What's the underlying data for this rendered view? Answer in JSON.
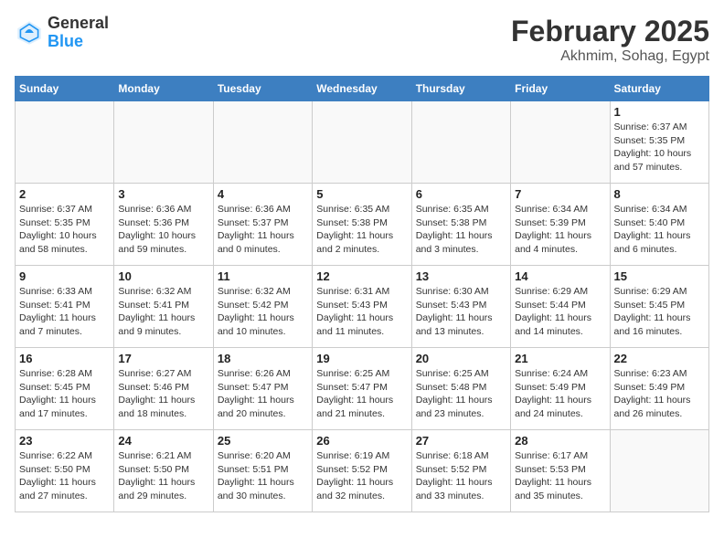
{
  "header": {
    "logo_general": "General",
    "logo_blue": "Blue",
    "month_title": "February 2025",
    "subtitle": "Akhmim, Sohag, Egypt"
  },
  "days_of_week": [
    "Sunday",
    "Monday",
    "Tuesday",
    "Wednesday",
    "Thursday",
    "Friday",
    "Saturday"
  ],
  "weeks": [
    [
      {
        "day": "",
        "info": ""
      },
      {
        "day": "",
        "info": ""
      },
      {
        "day": "",
        "info": ""
      },
      {
        "day": "",
        "info": ""
      },
      {
        "day": "",
        "info": ""
      },
      {
        "day": "",
        "info": ""
      },
      {
        "day": "1",
        "info": "Sunrise: 6:37 AM\nSunset: 5:35 PM\nDaylight: 10 hours and 57 minutes."
      }
    ],
    [
      {
        "day": "2",
        "info": "Sunrise: 6:37 AM\nSunset: 5:35 PM\nDaylight: 10 hours and 58 minutes."
      },
      {
        "day": "3",
        "info": "Sunrise: 6:36 AM\nSunset: 5:36 PM\nDaylight: 10 hours and 59 minutes."
      },
      {
        "day": "4",
        "info": "Sunrise: 6:36 AM\nSunset: 5:37 PM\nDaylight: 11 hours and 0 minutes."
      },
      {
        "day": "5",
        "info": "Sunrise: 6:35 AM\nSunset: 5:38 PM\nDaylight: 11 hours and 2 minutes."
      },
      {
        "day": "6",
        "info": "Sunrise: 6:35 AM\nSunset: 5:38 PM\nDaylight: 11 hours and 3 minutes."
      },
      {
        "day": "7",
        "info": "Sunrise: 6:34 AM\nSunset: 5:39 PM\nDaylight: 11 hours and 4 minutes."
      },
      {
        "day": "8",
        "info": "Sunrise: 6:34 AM\nSunset: 5:40 PM\nDaylight: 11 hours and 6 minutes."
      }
    ],
    [
      {
        "day": "9",
        "info": "Sunrise: 6:33 AM\nSunset: 5:41 PM\nDaylight: 11 hours and 7 minutes."
      },
      {
        "day": "10",
        "info": "Sunrise: 6:32 AM\nSunset: 5:41 PM\nDaylight: 11 hours and 9 minutes."
      },
      {
        "day": "11",
        "info": "Sunrise: 6:32 AM\nSunset: 5:42 PM\nDaylight: 11 hours and 10 minutes."
      },
      {
        "day": "12",
        "info": "Sunrise: 6:31 AM\nSunset: 5:43 PM\nDaylight: 11 hours and 11 minutes."
      },
      {
        "day": "13",
        "info": "Sunrise: 6:30 AM\nSunset: 5:43 PM\nDaylight: 11 hours and 13 minutes."
      },
      {
        "day": "14",
        "info": "Sunrise: 6:29 AM\nSunset: 5:44 PM\nDaylight: 11 hours and 14 minutes."
      },
      {
        "day": "15",
        "info": "Sunrise: 6:29 AM\nSunset: 5:45 PM\nDaylight: 11 hours and 16 minutes."
      }
    ],
    [
      {
        "day": "16",
        "info": "Sunrise: 6:28 AM\nSunset: 5:45 PM\nDaylight: 11 hours and 17 minutes."
      },
      {
        "day": "17",
        "info": "Sunrise: 6:27 AM\nSunset: 5:46 PM\nDaylight: 11 hours and 18 minutes."
      },
      {
        "day": "18",
        "info": "Sunrise: 6:26 AM\nSunset: 5:47 PM\nDaylight: 11 hours and 20 minutes."
      },
      {
        "day": "19",
        "info": "Sunrise: 6:25 AM\nSunset: 5:47 PM\nDaylight: 11 hours and 21 minutes."
      },
      {
        "day": "20",
        "info": "Sunrise: 6:25 AM\nSunset: 5:48 PM\nDaylight: 11 hours and 23 minutes."
      },
      {
        "day": "21",
        "info": "Sunrise: 6:24 AM\nSunset: 5:49 PM\nDaylight: 11 hours and 24 minutes."
      },
      {
        "day": "22",
        "info": "Sunrise: 6:23 AM\nSunset: 5:49 PM\nDaylight: 11 hours and 26 minutes."
      }
    ],
    [
      {
        "day": "23",
        "info": "Sunrise: 6:22 AM\nSunset: 5:50 PM\nDaylight: 11 hours and 27 minutes."
      },
      {
        "day": "24",
        "info": "Sunrise: 6:21 AM\nSunset: 5:50 PM\nDaylight: 11 hours and 29 minutes."
      },
      {
        "day": "25",
        "info": "Sunrise: 6:20 AM\nSunset: 5:51 PM\nDaylight: 11 hours and 30 minutes."
      },
      {
        "day": "26",
        "info": "Sunrise: 6:19 AM\nSunset: 5:52 PM\nDaylight: 11 hours and 32 minutes."
      },
      {
        "day": "27",
        "info": "Sunrise: 6:18 AM\nSunset: 5:52 PM\nDaylight: 11 hours and 33 minutes."
      },
      {
        "day": "28",
        "info": "Sunrise: 6:17 AM\nSunset: 5:53 PM\nDaylight: 11 hours and 35 minutes."
      },
      {
        "day": "",
        "info": ""
      }
    ]
  ]
}
